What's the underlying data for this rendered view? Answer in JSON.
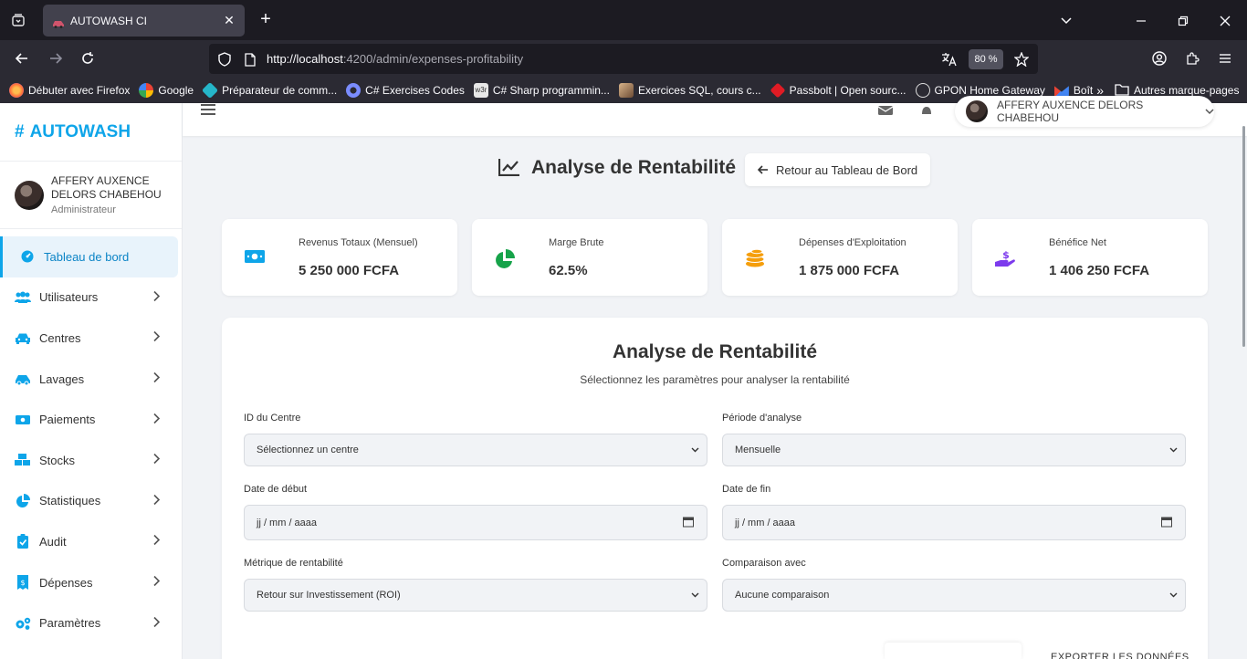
{
  "browser": {
    "tab_title": "AUTOWASH CI",
    "url_host": "http://localhost",
    "url_path": ":4200/admin/expenses-profitability",
    "zoom": "80 %",
    "bookmarks": [
      {
        "label": "Débuter avec Firefox",
        "icon": "firefox-icon",
        "color": "#ff7139"
      },
      {
        "label": "Google",
        "icon": "google-icon",
        "color": "#4285f4"
      },
      {
        "label": "Préparateur de comm...",
        "icon": "puzzle-icon",
        "color": "#25b6c9"
      },
      {
        "label": "C# Exercises Codes",
        "icon": "gear-icon",
        "color": "#7a8cff"
      },
      {
        "label": "C# Sharp programmin...",
        "icon": "w3r-icon",
        "color": "#e8e8e8"
      },
      {
        "label": "Exercices SQL, cours c...",
        "icon": "image-icon",
        "color": "#b08a60"
      },
      {
        "label": "Passbolt | Open sourc...",
        "icon": "passbolt-icon",
        "color": "#e01b24"
      },
      {
        "label": "GPON Home Gateway",
        "icon": "globe-icon",
        "color": "#dddddd"
      },
      {
        "label": "Boît",
        "icon": "gmail-icon",
        "color": "#ea4335"
      }
    ],
    "overflow_label": "Autres marque-pages"
  },
  "brand": {
    "hash": "#",
    "name": "AUTOWASH"
  },
  "user": {
    "name": "AFFERY AUXENCE DELORS CHABEHOU",
    "role": "Administrateur"
  },
  "topbar": {
    "profile_name": "AFFERY AUXENCE DELORS CHABEHOU"
  },
  "menu": [
    {
      "label": "Tableau de bord",
      "icon": "dashboard-icon",
      "active": true
    },
    {
      "label": "Utilisateurs",
      "icon": "users-icon"
    },
    {
      "label": "Centres",
      "icon": "car-icon"
    },
    {
      "label": "Lavages",
      "icon": "car-wash-icon"
    },
    {
      "label": "Paiements",
      "icon": "money-icon"
    },
    {
      "label": "Stocks",
      "icon": "boxes-icon"
    },
    {
      "label": "Statistiques",
      "icon": "pie-chart-icon"
    },
    {
      "label": "Audit",
      "icon": "clipboard-check-icon"
    },
    {
      "label": "Dépenses",
      "icon": "receipt-icon"
    },
    {
      "label": "Paramètres",
      "icon": "gears-icon"
    }
  ],
  "page": {
    "title": "Analyse de Rentabilité",
    "back_label": "Retour au Tableau de Bord"
  },
  "cards": [
    {
      "label": "Revenus Totaux (Mensuel)",
      "value": "5 250 000 FCFA",
      "icon": "money-bill-icon",
      "color": "#0ea5e9"
    },
    {
      "label": "Marge Brute",
      "value": "62.5%",
      "icon": "pie-chart-icon",
      "color": "#16a34a"
    },
    {
      "label": "Dépenses d'Exploitation",
      "value": "1 875 000 FCFA",
      "icon": "coins-icon",
      "color": "#f59e0b"
    },
    {
      "label": "Bénéfice Net",
      "value": "1 406 250 FCFA",
      "icon": "hand-holding-dollar-icon",
      "color": "#7c3aed"
    }
  ],
  "form": {
    "title": "Analyse de Rentabilité",
    "subtitle": "Sélectionnez les paramètres pour analyser la rentabilité",
    "center_label": "ID du Centre",
    "center_value": "Sélectionnez un centre",
    "period_label": "Période d'analyse",
    "period_value": "Mensuelle",
    "start_label": "Date de début",
    "start_placeholder": "jj / mm / aaaa",
    "end_label": "Date de fin",
    "end_placeholder": "jj / mm / aaaa",
    "metric_label": "Métrique de rentabilité",
    "metric_value": "Retour sur Investissement (ROI)",
    "compare_label": "Comparaison avec",
    "compare_value": "Aucune comparaison",
    "export_label": "EXPORTER LES DONNÉES"
  }
}
